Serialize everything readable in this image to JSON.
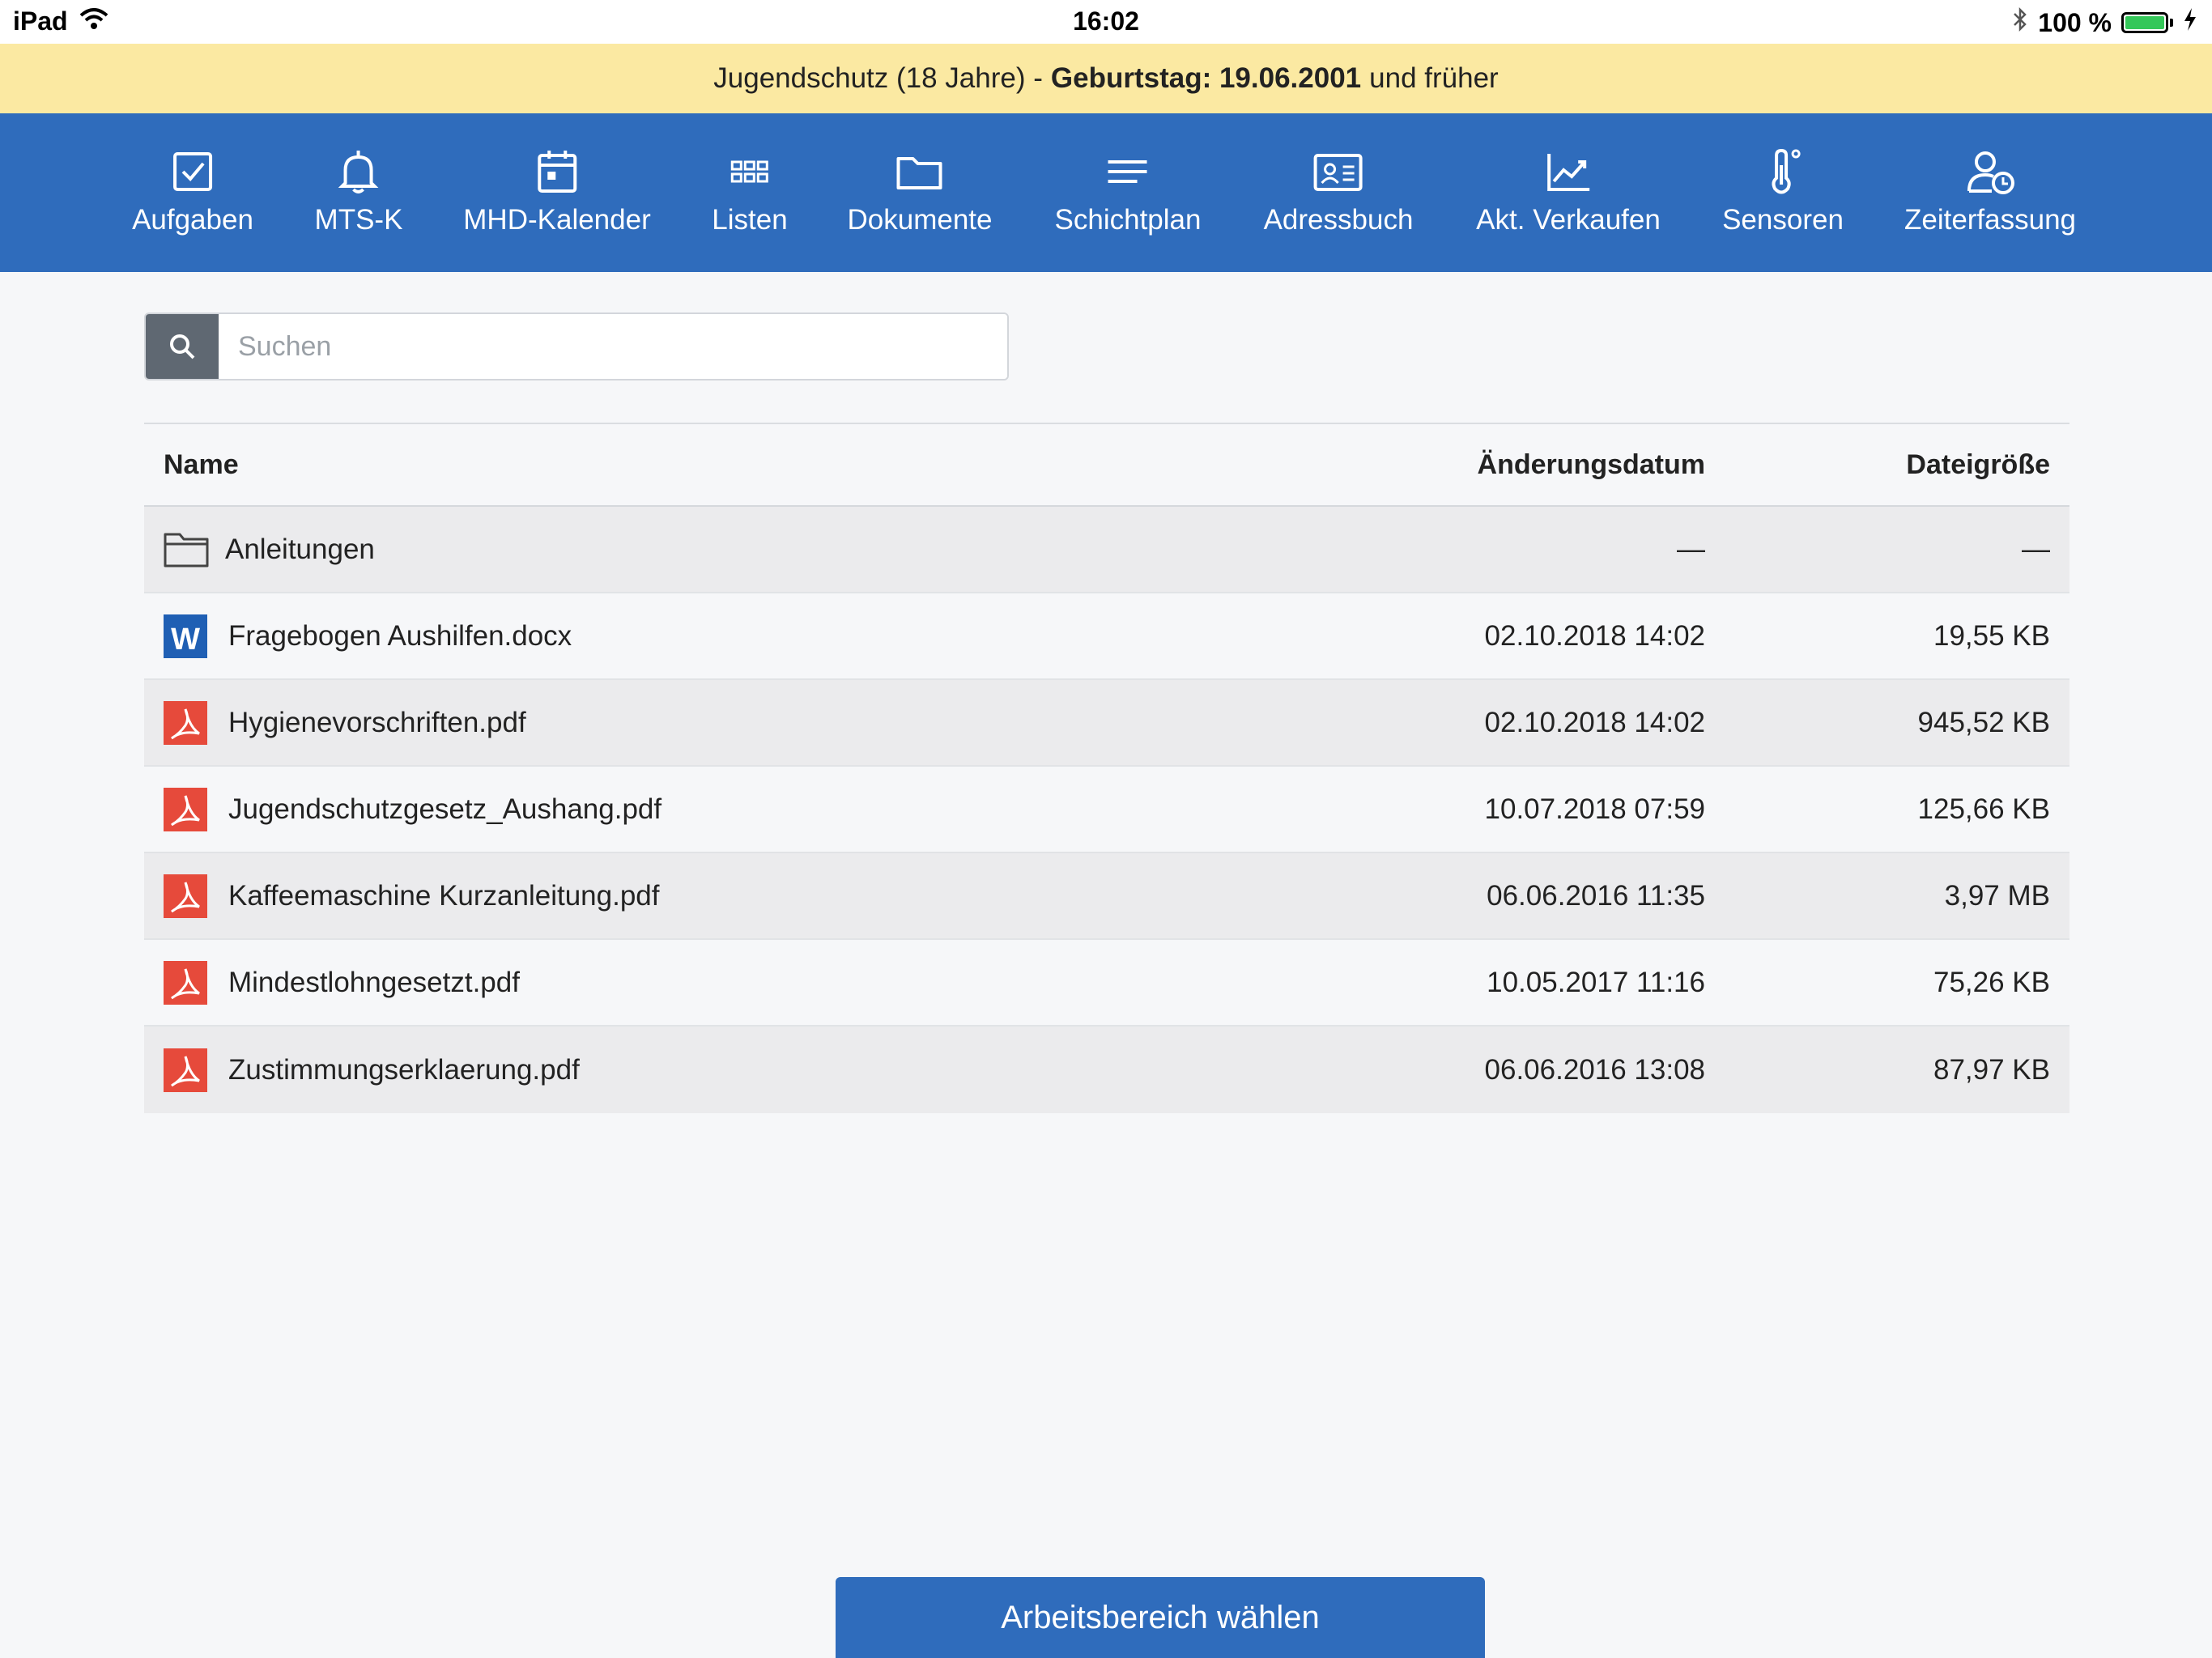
{
  "status_bar": {
    "device": "iPad",
    "time": "16:02",
    "battery": "100 %"
  },
  "banner": {
    "prefix": "Jugendschutz (18 Jahre) -",
    "bold": "Geburtstag: 19.06.2001",
    "suffix": "und früher"
  },
  "nav": {
    "items": [
      {
        "label": "Aufgaben",
        "icon": "checkbox-icon"
      },
      {
        "label": "MTS-K",
        "icon": "bell-icon"
      },
      {
        "label": "MHD-Kalender",
        "icon": "calendar-icon"
      },
      {
        "label": "Listen",
        "icon": "grid-icon"
      },
      {
        "label": "Dokumente",
        "icon": "folder-icon"
      },
      {
        "label": "Schichtplan",
        "icon": "lines-icon"
      },
      {
        "label": "Adressbuch",
        "icon": "contact-card-icon"
      },
      {
        "label": "Akt. Verkaufen",
        "icon": "chart-up-icon"
      },
      {
        "label": "Sensoren",
        "icon": "thermometer-icon"
      },
      {
        "label": "Zeiterfassung",
        "icon": "user-clock-icon"
      }
    ]
  },
  "search": {
    "placeholder": "Suchen"
  },
  "table": {
    "headers": {
      "name": "Name",
      "date": "Änderungsdatum",
      "size": "Dateigröße"
    },
    "rows": [
      {
        "name": "Anleitungen",
        "type": "folder",
        "date": "—",
        "size": "—"
      },
      {
        "name": "Fragebogen Aushilfen.docx",
        "type": "word",
        "date": "02.10.2018 14:02",
        "size": "19,55 KB"
      },
      {
        "name": "Hygienevorschriften.pdf",
        "type": "pdf",
        "date": "02.10.2018 14:02",
        "size": "945,52 KB"
      },
      {
        "name": "Jugendschutzgesetz_Aushang.pdf",
        "type": "pdf",
        "date": "10.07.2018 07:59",
        "size": "125,66 KB"
      },
      {
        "name": "Kaffeemaschine Kurzanleitung.pdf",
        "type": "pdf",
        "date": "06.06.2016 11:35",
        "size": "3,97 MB"
      },
      {
        "name": "Mindestlohngesetzt.pdf",
        "type": "pdf",
        "date": "10.05.2017 11:16",
        "size": "75,26 KB"
      },
      {
        "name": "Zustimmungserklaerung.pdf",
        "type": "pdf",
        "date": "06.06.2016 13:08",
        "size": "87,97 KB"
      }
    ]
  },
  "bottom_button": {
    "label": "Arbeitsbereich wählen"
  },
  "colors": {
    "nav_bg": "#2f6cbc",
    "banner_bg": "#fbe9a2",
    "pdf_red": "#e64a3b",
    "word_blue": "#1f5fb4",
    "battery_green": "#34c759"
  }
}
